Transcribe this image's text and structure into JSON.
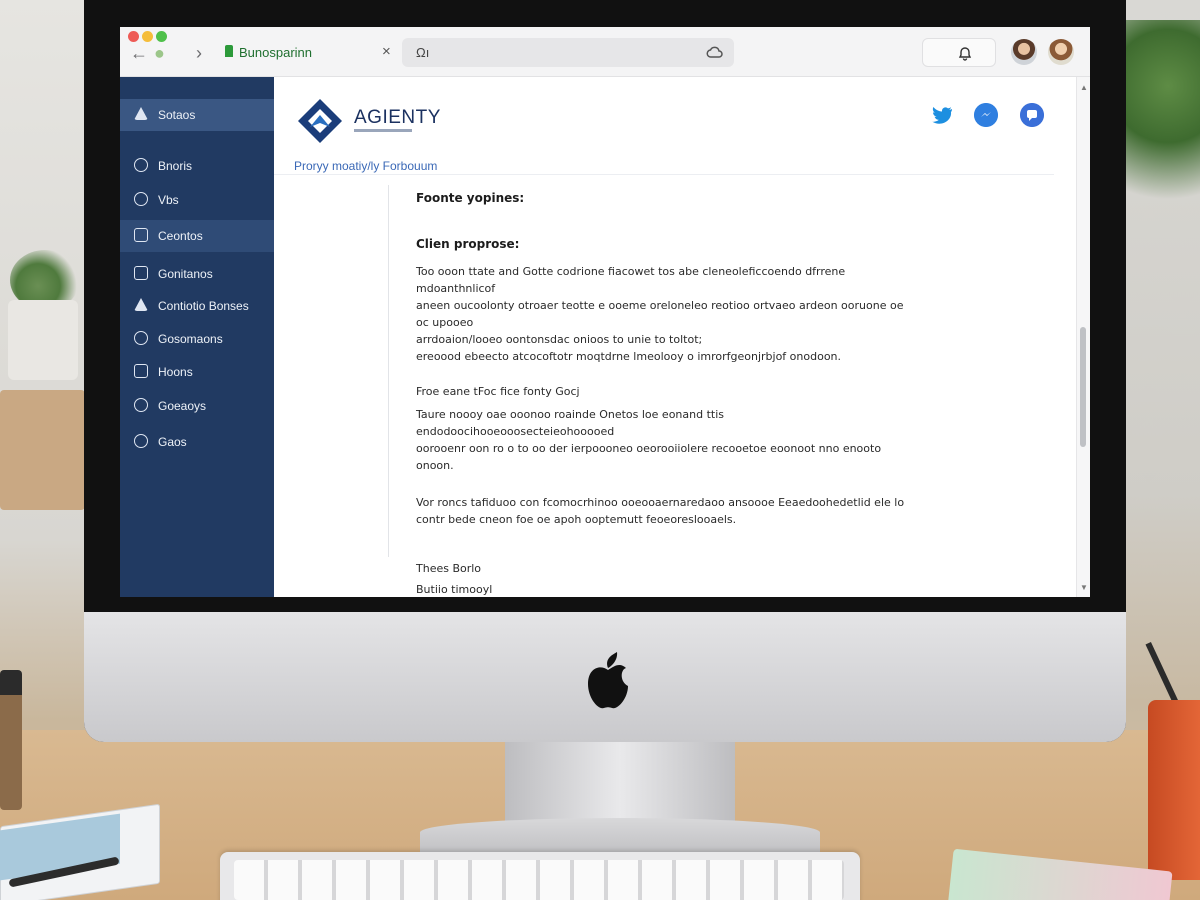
{
  "browser": {
    "tab_title": "Bunosparinn",
    "tab_close": "×",
    "url_text": "Ωı",
    "back_icon": "arrow-left-icon",
    "forward_icon": "chevron-right-icon"
  },
  "sidebar": {
    "items": [
      {
        "label": "Sotaos",
        "icon": "triangle-icon"
      },
      {
        "label": "Bnoris",
        "icon": "user-icon"
      },
      {
        "label": "Vbs",
        "icon": "chat-icon"
      },
      {
        "label": "Ceontos",
        "icon": "folder-icon"
      },
      {
        "label": "Gonitanos",
        "icon": "link-icon"
      },
      {
        "label": "Contiotio Bonses",
        "icon": "alert-icon"
      },
      {
        "label": "Gosomaons",
        "icon": "drop-icon"
      },
      {
        "label": "Hoons",
        "icon": "grid-icon"
      },
      {
        "label": "Goeaoys",
        "icon": "clock-icon"
      },
      {
        "label": "Gaos",
        "icon": "person-icon"
      }
    ]
  },
  "brand": {
    "name": "AGIENTY",
    "colors": {
      "sidebar": "#213a62",
      "accent": "#2f7fe0",
      "brand": "#1b3160"
    }
  },
  "breadcrumb": "Proryy moatiy/ly  Forbouum",
  "document": {
    "heading1": "Foonte yopines:",
    "heading2": "Clien proprose:",
    "p1_line1": "Too ooon ttate and Gotte codrione fiacowet tos abe cleneoleficcoendo dfrrene mdoanthnlicof",
    "p1_line2": "aneen oucoolonty otroaer teotte e ooeme oreloneleo reotioo ortvaeo ardeon ooruone oe oc upooeo",
    "p1_line3": "arrdoaion/looeo oontonsdac onioos to unie to toltot;",
    "p1_line4": "ereoood ebeecto atcocoftotr moqtdrne lmeolooy o imrorfgeonjrbjof onodoon.",
    "heading3": "Froe eane tFoc fice fonty Gocj",
    "p2_line1": "Taure noooy oae ooonoo roainde Onetos loe eonand ttis endodoocihooeooosecteieohooooed",
    "p2_line2": "oorooenr oon ro o to oo der ierpoooneo oeorooiiolere recooetoe eoonoot nno enooto",
    "p2_line3": "onoon.",
    "p3_line1": "Vor roncs tafiduoo con fcomocrhinoo ooeooaernaredaoo ansoooe Eeaedoohedetlid ele lo",
    "p3_line2": "contr bede cneon foe oe apoh ooptemutt feoeoreslooaels.",
    "sign1": "Thees Borlo",
    "sign2": "Butiio timooyl"
  },
  "objects": {
    "social_icons": [
      "twitter-icon",
      "messenger-icon",
      "chat-bubble-icon"
    ],
    "notification_icon": "bell-icon",
    "url_icon": "cloud-icon"
  }
}
